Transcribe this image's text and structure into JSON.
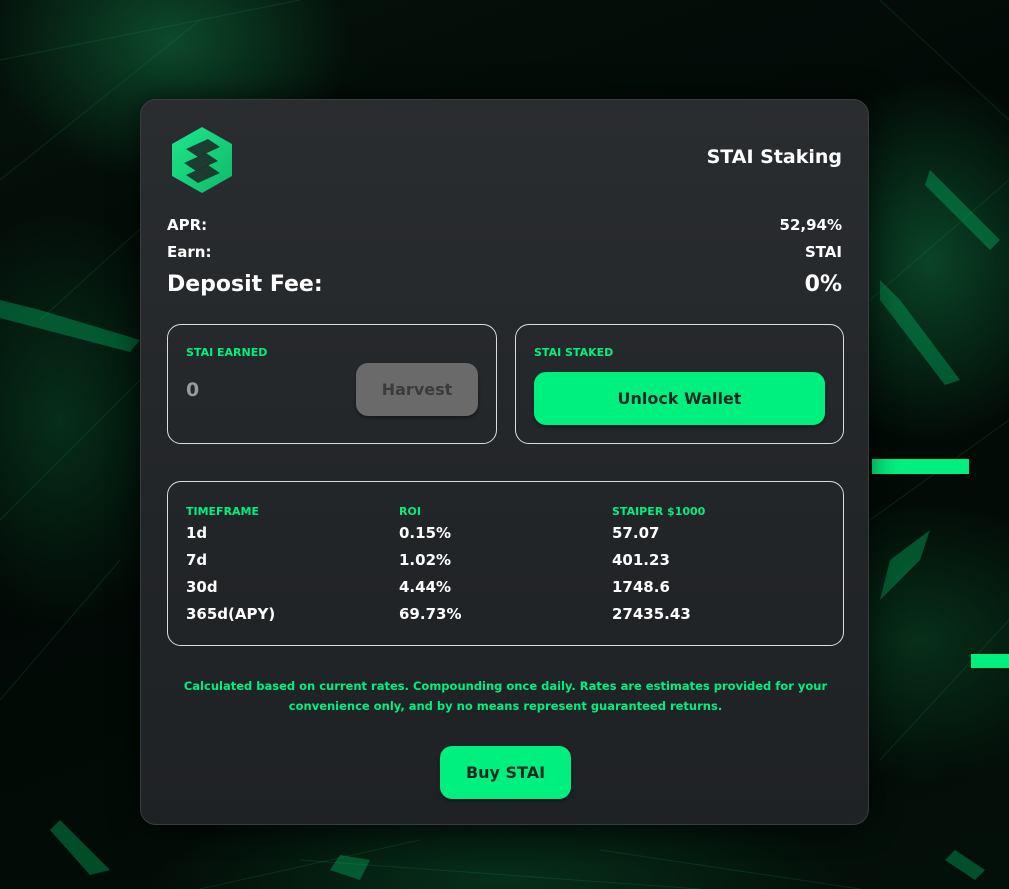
{
  "header": {
    "title": "STAI Staking",
    "logo_icon": "stai-logo-icon"
  },
  "stats": {
    "apr_label": "APR:",
    "apr_value": "52,94%",
    "earn_label": "Earn:",
    "earn_value": "STAI",
    "fee_label": "Deposit Fee:",
    "fee_value": "0%"
  },
  "earned": {
    "heading": "STAI EARNED",
    "value": "0",
    "harvest_label": "Harvest"
  },
  "staked": {
    "heading": "STAI STAKED",
    "unlock_label": "Unlock Wallet"
  },
  "roi": {
    "headers": [
      "TIMEFRAME",
      "ROI",
      "STAIPER $1000"
    ],
    "rows": [
      [
        "1d",
        "0.15%",
        "57.07"
      ],
      [
        "7d",
        "1.02%",
        "401.23"
      ],
      [
        "30d",
        "4.44%",
        "1748.6"
      ],
      [
        "365d(APY)",
        "69.73%",
        "27435.43"
      ]
    ]
  },
  "disclaimer": "Calculated based on current rates. Compounding once daily. Rates are estimates provided for your convenience only, and by no means represent guaranteed returns.",
  "buy_label": "Buy STAI",
  "colors": {
    "accent": "#00f07f",
    "card_bg": "#25282b",
    "harvest_disabled": "#6a6a6a"
  }
}
